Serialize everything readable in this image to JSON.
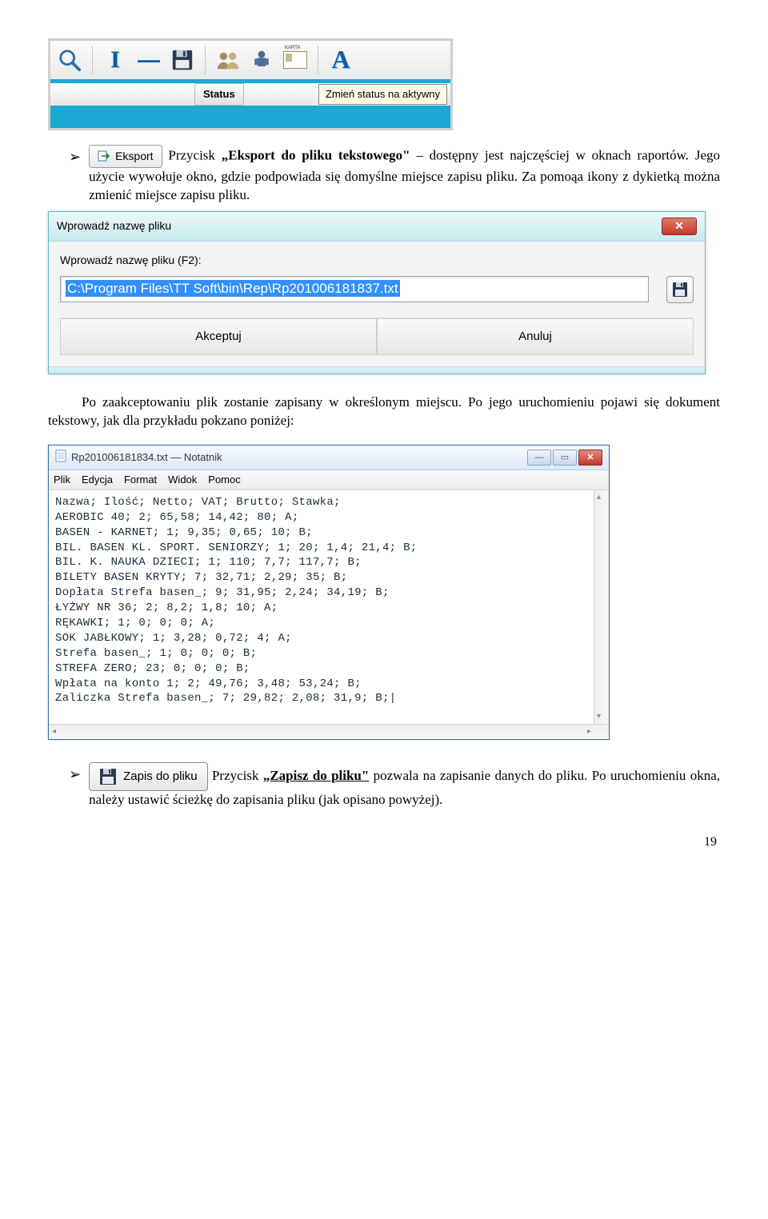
{
  "toolbar": {
    "status_label": "Status",
    "tooltip": "Zmień status na aktywny",
    "card_caption": "KARTA"
  },
  "eksport_button": {
    "label": "Eksport"
  },
  "paragraph1_part1": "Przycisk ",
  "paragraph1_bold1": "„Eksport do pliku tekstowego\"",
  "paragraph1_rest": " – dostępny jest najczęściej w oknach raportów. Jego użycie wywołuje okno, gdzie podpowiada się domyślne miejsce zapisu pliku. Za pomoąa ikony z dykietką można zmienić miejsce zapisu pliku.",
  "dialog": {
    "title": "Wprowadź nazwę pliku",
    "field_label": "Wprowadź nazwę pliku (F2):",
    "input_value": "C:\\Program Files\\TT Soft\\bin\\Rep\\Rp201006181837.txt",
    "accept": "Akceptuj",
    "cancel": "Anuluj"
  },
  "paragraph2": "Po zaakceptowaniu plik zostanie zapisany w określonym miejscu. Po jego uruchomieniu pojawi się dokument tekstowy, jak dla przykładu pokzano poniżej:",
  "notepad": {
    "title": "Rp201006181834.txt — Notatnik",
    "menu": [
      "Plik",
      "Edycja",
      "Format",
      "Widok",
      "Pomoc"
    ],
    "content": "Nazwa; Ilość; Netto; VAT; Brutto; Stawka;\nAEROBIC 40; 2; 65,58; 14,42; 80; A;\nBASEN - KARNET; 1; 9,35; 0,65; 10; B;\nBIL. BASEN KL. SPORT. SENIORZY; 1; 20; 1,4; 21,4; B;\nBIL. K. NAUKA DZIECI; 1; 110; 7,7; 117,7; B;\nBILETY BASEN KRYTY; 7; 32,71; 2,29; 35; B;\nDopłata Strefa basen_; 9; 31,95; 2,24; 34,19; B;\nŁYŻWY NR 36; 2; 8,2; 1,8; 10; A;\nRĘKAWKI; 1; 0; 0; 0; A;\nSOK JABŁKOWY; 1; 3,28; 0,72; 4; A;\nStrefa basen_; 1; 0; 0; 0; B;\nSTREFA ZERO; 23; 0; 0; 0; B;\nWpłata na konto 1; 2; 49,76; 3,48; 53,24; B;\nZaliczka Strefa basen_; 7; 29,82; 2,08; 31,9; B;|"
  },
  "zapis_button": {
    "label": "Zapis do pliku"
  },
  "paragraph3_part1": "Przycisk ",
  "paragraph3_bold1": "„Zapisz do pliku\"",
  "paragraph3_rest": " pozwala na zapisanie danych do pliku. Po uruchomieniu okna, należy ustawić ścieżkę do zapisania pliku (jak opisano powyżej).",
  "page_number": "19"
}
